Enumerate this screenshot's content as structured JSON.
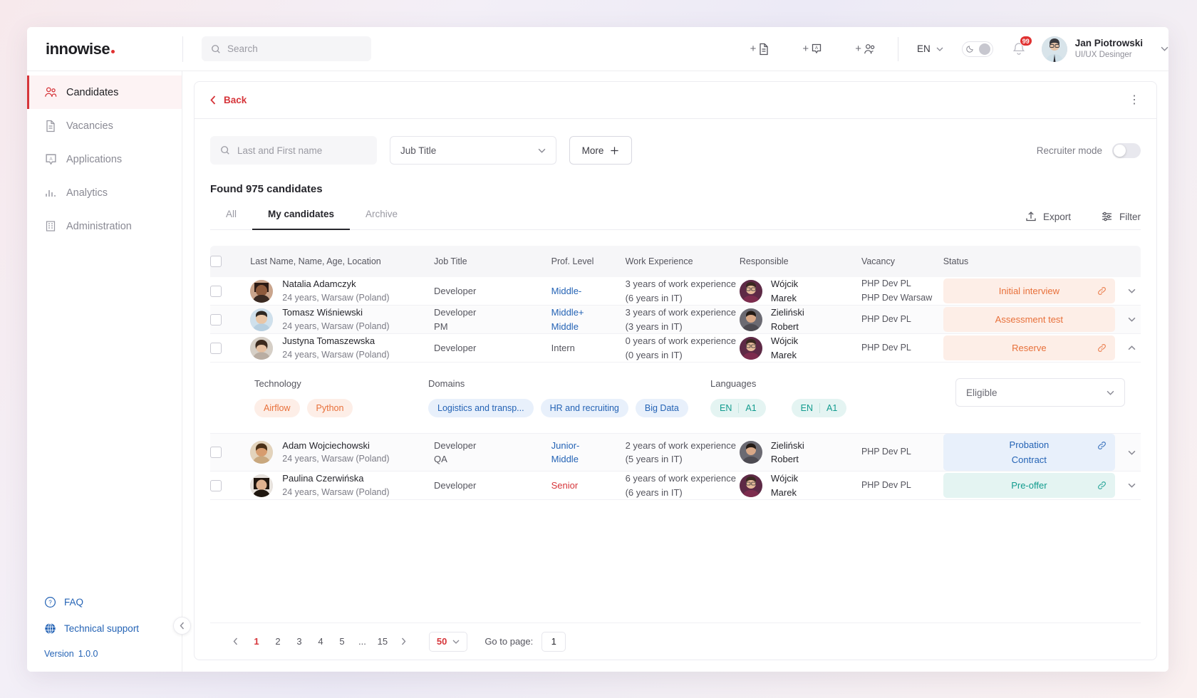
{
  "brand": {
    "name": "innowise"
  },
  "topbar": {
    "search_placeholder": "Search",
    "add_document_icon": "add-document-icon",
    "add_application_icon": "add-application-icon",
    "add_candidate_icon": "add-candidate-icon",
    "language": "EN",
    "theme_toggle_icon": "moon-icon",
    "notifications_count": "99",
    "user_name": "Jan Piotrowski",
    "user_role": "UI/UX Desinger"
  },
  "sidebar": {
    "items": [
      {
        "label": "Candidates",
        "icon": "people-icon",
        "active": true
      },
      {
        "label": "Vacancies",
        "icon": "document-icon",
        "active": false
      },
      {
        "label": "Applications",
        "icon": "application-icon",
        "active": false
      },
      {
        "label": "Analytics",
        "icon": "bar-chart-icon",
        "active": false
      },
      {
        "label": "Administration",
        "icon": "building-icon",
        "active": false
      }
    ],
    "help": [
      {
        "label": "FAQ",
        "icon": "question-circle-icon"
      },
      {
        "label": "Technical support",
        "icon": "globe-icon"
      }
    ],
    "version_label": "Version",
    "version_value": "1.0.0"
  },
  "panel": {
    "back_label": "Back",
    "kebab_icon": "more-vertical-icon"
  },
  "filters": {
    "name_placeholder": "Last and First name",
    "job_title_value": "Jub Title",
    "more_label": "More",
    "recruiter_mode_label": "Recruiter mode"
  },
  "results": {
    "found_label": "Found 975 candidates",
    "tabs": [
      {
        "label": "All",
        "active": false
      },
      {
        "label": "My candidates",
        "active": true
      },
      {
        "label": "Archive",
        "active": false
      }
    ],
    "export_label": "Export",
    "filter_label": "Filter"
  },
  "table": {
    "columns": [
      "Last Name, Name, Age, Location",
      "Job Title",
      "Prof. Level",
      "Work Experience",
      "Responsible",
      "Vacancy",
      "Status"
    ],
    "rows": [
      {
        "name": "Natalia Adamczyk",
        "meta": "24 years, Warsaw (Poland)",
        "job_title": [
          "Developer"
        ],
        "level": [
          "Middle-"
        ],
        "level_style": "link",
        "experience": [
          "3 years of work experience",
          "(6 years in IT)"
        ],
        "responsible": [
          "Wójcik",
          "Marek"
        ],
        "vacancy": [
          "PHP Dev PL",
          "PHP Dev Warsaw"
        ],
        "status": [
          "Initial interview"
        ],
        "status_style": "orange",
        "status_link": true,
        "expanded": false
      },
      {
        "name": "Tomasz Wiśniewski",
        "meta": "24 years, Warsaw (Poland)",
        "job_title": [
          "Developer",
          "PM"
        ],
        "level": [
          "Middle+",
          "Middle"
        ],
        "level_style": "link",
        "experience": [
          "3 years of work experience",
          "(3 years in IT)"
        ],
        "responsible": [
          "Zieliński",
          "Robert"
        ],
        "vacancy": [
          "PHP Dev PL"
        ],
        "status": [
          "Assessment test"
        ],
        "status_style": "peach",
        "status_link": false,
        "expanded": false
      },
      {
        "name": "Justyna Tomaszewska",
        "meta": "24 years, Warsaw (Poland)",
        "job_title": [
          "Developer"
        ],
        "level": [
          "Intern"
        ],
        "level_style": "plain",
        "experience": [
          "0 years of work experience",
          "(0 years in IT)"
        ],
        "responsible": [
          "Wójcik",
          "Marek"
        ],
        "vacancy": [
          "PHP Dev PL"
        ],
        "status": [
          "Reserve"
        ],
        "status_style": "peach",
        "status_link": true,
        "expanded": true
      },
      {
        "name": "Adam Wojciechowski",
        "meta": "24 years, Warsaw (Poland)",
        "job_title": [
          "Developer",
          "QA"
        ],
        "level": [
          "Junior-",
          "Middle"
        ],
        "level_style": "link",
        "experience": [
          "2 years of work experience",
          "(5 years in IT)"
        ],
        "responsible": [
          "Zieliński",
          "Robert"
        ],
        "vacancy": [
          "PHP Dev PL"
        ],
        "status": [
          "Probation",
          "Contract"
        ],
        "status_style": "blue",
        "status_link": true,
        "expanded": false
      },
      {
        "name": "Paulina Czerwińska",
        "meta": "24 years, Warsaw (Poland)",
        "job_title": [
          "Developer"
        ],
        "level": [
          "Senior"
        ],
        "level_style": "senior",
        "experience": [
          "6 years of work experience",
          "(6 years in IT)"
        ],
        "responsible": [
          "Wójcik",
          "Marek"
        ],
        "vacancy": [
          "PHP Dev PL"
        ],
        "status": [
          "Pre-offer"
        ],
        "status_style": "teal",
        "status_link": true,
        "expanded": false
      }
    ],
    "detail": {
      "technology_label": "Technology",
      "technology": [
        "Airflow",
        "Python"
      ],
      "domains_label": "Domains",
      "domains": [
        "Logistics and transp...",
        "HR and recruiting",
        "Big Data"
      ],
      "languages_label": "Languages",
      "languages": [
        {
          "code": "EN",
          "level": "A1"
        },
        {
          "code": "EN",
          "level": "A1"
        }
      ],
      "eligibility_value": "Eligible"
    }
  },
  "pagination": {
    "pages": [
      "1",
      "2",
      "3",
      "4",
      "5"
    ],
    "dots": "...",
    "last_page": "15",
    "active_page": "1",
    "per_page": "50",
    "goto_label": "Go to page:",
    "goto_value": "1"
  }
}
